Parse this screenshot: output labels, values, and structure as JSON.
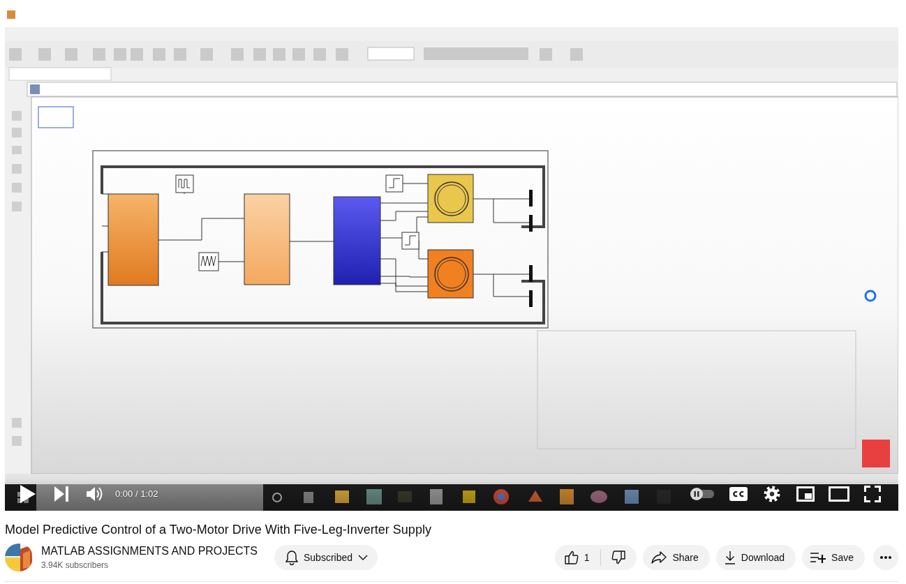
{
  "player": {
    "time": "0:00 / 1:02",
    "autoplay": false
  },
  "video": {
    "title": "Model Predictive Control of a Two-Motor Drive With Five-Leg-Inverter Supply"
  },
  "channel": {
    "name": "MATLAB ASSIGNMENTS AND PROJECTS",
    "subscribers": "3.94K subscribers"
  },
  "subscribe_button": {
    "label": "Subscribed"
  },
  "actions": [
    {
      "kind": "like",
      "label": "1"
    },
    {
      "kind": "dislike"
    },
    {
      "kind": "share",
      "label": "Share"
    },
    {
      "kind": "download",
      "label": "Download"
    },
    {
      "kind": "save",
      "label": "Save"
    },
    {
      "kind": "more"
    }
  ]
}
